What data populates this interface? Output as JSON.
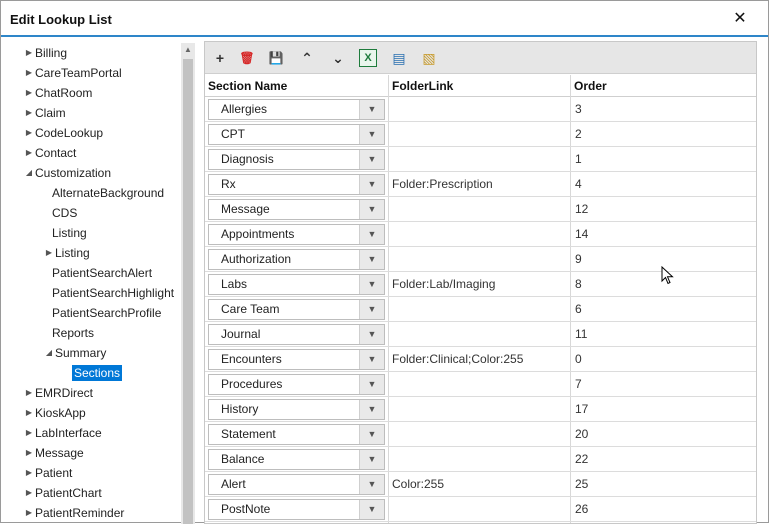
{
  "window": {
    "title": "Edit Lookup List",
    "close_glyph": "✕"
  },
  "tree": {
    "items": [
      {
        "label": "Billing",
        "arrow": "right"
      },
      {
        "label": "CareTeamPortal",
        "arrow": "right"
      },
      {
        "label": "ChatRoom",
        "arrow": "right"
      },
      {
        "label": "Claim",
        "arrow": "right"
      },
      {
        "label": "CodeLookup",
        "arrow": "right"
      },
      {
        "label": "Contact",
        "arrow": "right"
      },
      {
        "label": "Customization",
        "arrow": "down"
      },
      {
        "label": "AlternateBackground",
        "arrow": "none"
      },
      {
        "label": "CDS",
        "arrow": "none"
      },
      {
        "label": "Listing",
        "arrow": "none"
      },
      {
        "label": "Listing",
        "arrow": "right"
      },
      {
        "label": "PatientSearchAlert",
        "arrow": "none"
      },
      {
        "label": "PatientSearchHighlight",
        "arrow": "none"
      },
      {
        "label": "PatientSearchProfile",
        "arrow": "none"
      },
      {
        "label": "Reports",
        "arrow": "none"
      },
      {
        "label": "Summary",
        "arrow": "down"
      },
      {
        "label": "Sections",
        "arrow": "none",
        "selected": true
      },
      {
        "label": "EMRDirect",
        "arrow": "right"
      },
      {
        "label": "KioskApp",
        "arrow": "right"
      },
      {
        "label": "LabInterface",
        "arrow": "right"
      },
      {
        "label": "Message",
        "arrow": "right"
      },
      {
        "label": "Patient",
        "arrow": "right"
      },
      {
        "label": "PatientChart",
        "arrow": "right"
      },
      {
        "label": "PatientReminder",
        "arrow": "right"
      }
    ]
  },
  "toolbar": {
    "buttons": [
      {
        "name": "add-icon",
        "glyph": "+",
        "color": "#333333"
      },
      {
        "name": "delete-icon",
        "glyph": "🗑",
        "color": "#d62828"
      },
      {
        "name": "save-icon",
        "glyph": "💾",
        "color": "#444444"
      },
      {
        "name": "move-up-icon",
        "glyph": "⌃",
        "color": "#333333"
      },
      {
        "name": "move-down-icon",
        "glyph": "⌄",
        "color": "#333333"
      },
      {
        "name": "excel-export-icon",
        "glyph": "X",
        "color": "#1e7b3c"
      },
      {
        "name": "csv-export-icon",
        "glyph": "▤",
        "color": "#2a6fb0"
      },
      {
        "name": "import-icon",
        "glyph": "▧",
        "color": "#c79a2b"
      }
    ]
  },
  "grid": {
    "headers": {
      "section_name": "Section Name",
      "folder_link": "FolderLink",
      "order": "Order"
    },
    "rows": [
      {
        "section": "Allergies",
        "folder": "",
        "order": "3"
      },
      {
        "section": "CPT",
        "folder": "",
        "order": "2"
      },
      {
        "section": "Diagnosis",
        "folder": "",
        "order": "1"
      },
      {
        "section": "Rx",
        "folder": "Folder:Prescription",
        "order": "4"
      },
      {
        "section": "Message",
        "folder": "",
        "order": "12"
      },
      {
        "section": "Appointments",
        "folder": "",
        "order": "14"
      },
      {
        "section": "Authorization",
        "folder": "",
        "order": "9"
      },
      {
        "section": "Labs",
        "folder": "Folder:Lab/Imaging",
        "order": "8"
      },
      {
        "section": "Care Team",
        "folder": "",
        "order": "6"
      },
      {
        "section": "Journal",
        "folder": "",
        "order": "11"
      },
      {
        "section": "Encounters",
        "folder": "Folder:Clinical;Color:255",
        "order": "0"
      },
      {
        "section": "Procedures",
        "folder": "",
        "order": "7"
      },
      {
        "section": "History",
        "folder": "",
        "order": "17"
      },
      {
        "section": "Statement",
        "folder": "",
        "order": "20"
      },
      {
        "section": "Balance",
        "folder": "",
        "order": "22"
      },
      {
        "section": "Alert",
        "folder": "Color:255",
        "order": "25"
      },
      {
        "section": "PostNote",
        "folder": "",
        "order": "26"
      }
    ]
  },
  "colors": {
    "accent": "#2e86c9",
    "selection": "#0078d7"
  }
}
